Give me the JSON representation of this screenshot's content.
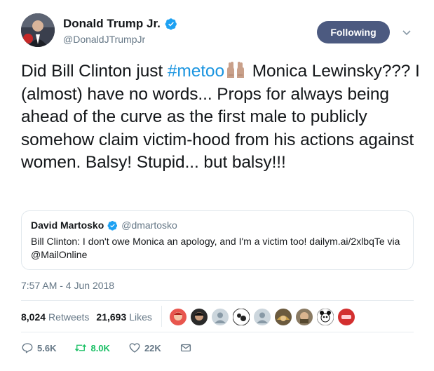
{
  "user": {
    "name": "Donald Trump Jr.",
    "handle": "@DonaldJTrumpJr",
    "follow_label": "Following"
  },
  "tweet": {
    "text_1": "Did Bill Clinton just ",
    "hashtag": "#metoo",
    "text_2": " Monica Lewinsky??? I (almost) have no words... Props for always being ahead of the curve as the first male to publicly somehow claim victim-hood from his actions against women. Balsy! Stupid... but balsy!!!"
  },
  "quoted": {
    "name": "David Martosko",
    "handle": "@dmartosko",
    "text": "Bill Clinton: I don't owe Monica an apology, and I'm a victim too! dailym.ai/2xlbqTe via @MailOnline"
  },
  "timestamp": "7:57 AM - 4 Jun 2018",
  "stats": {
    "retweets_count": "8,024",
    "retweets_label": "Retweets",
    "likes_count": "21,693",
    "likes_label": "Likes"
  },
  "actions": {
    "replies": "5.6K",
    "retweets": "8.0K",
    "likes": "22K"
  },
  "colors": {
    "follow_bg": "#4c5a80",
    "hashtag": "#1b95e0",
    "retweet_green": "#17bf63",
    "verified_blue": "#1da1f2"
  },
  "icons": {
    "verified": "verified-badge-icon",
    "caret": "chevron-down-icon",
    "reply": "reply-icon",
    "retweet": "retweet-icon",
    "like": "heart-icon",
    "dm": "envelope-icon"
  }
}
